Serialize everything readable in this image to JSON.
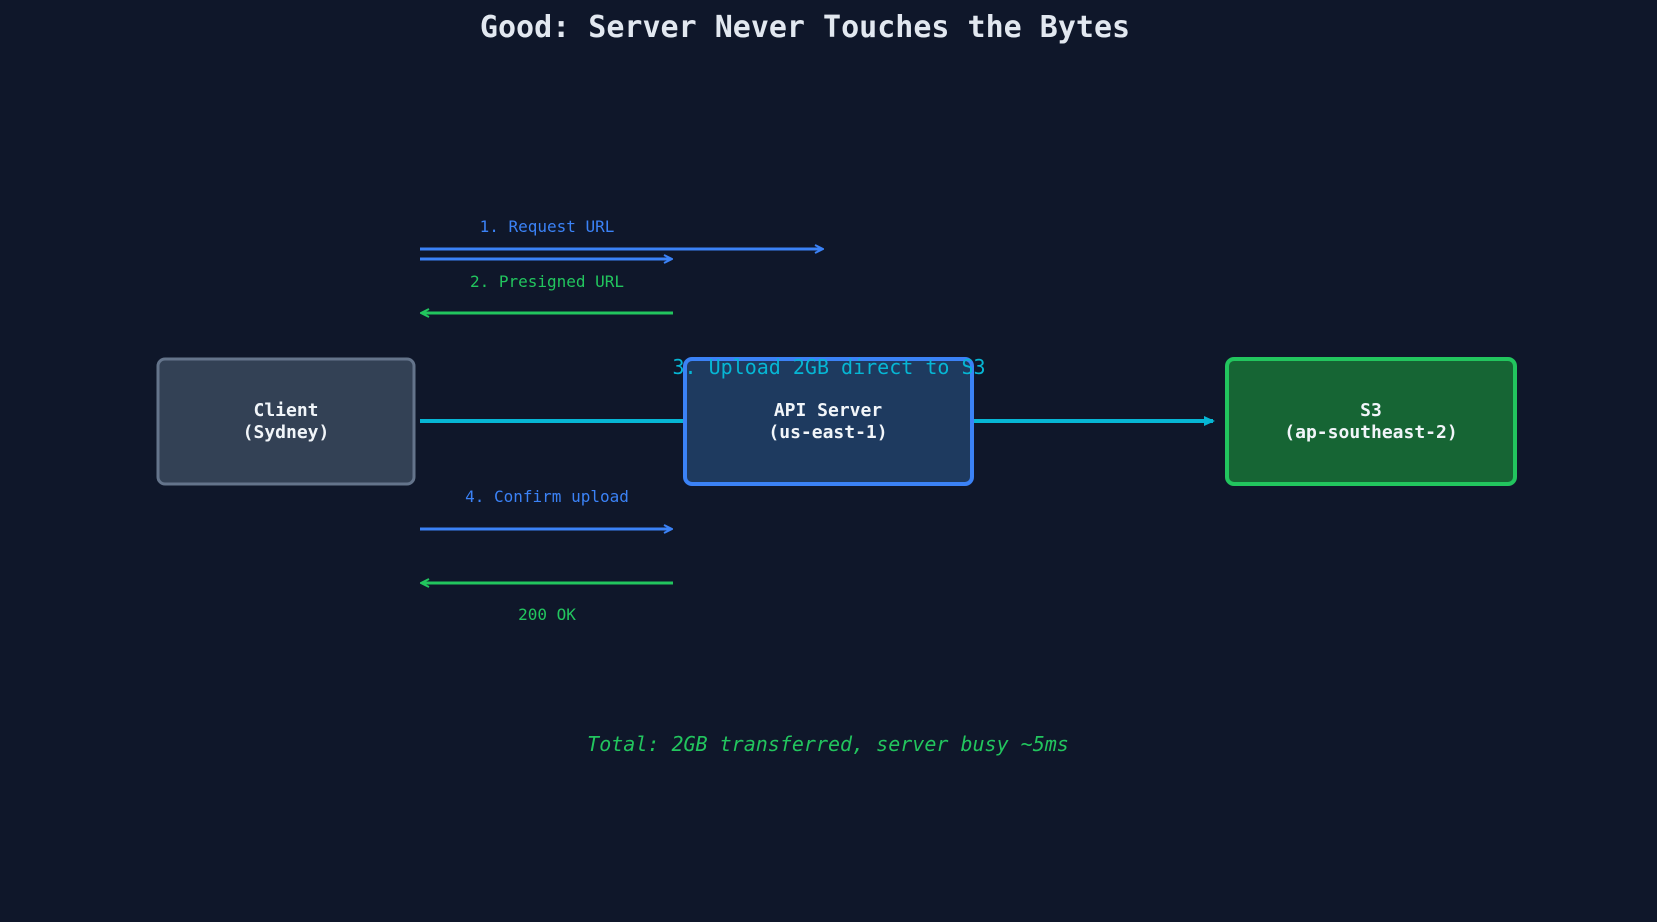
{
  "title": "Good: Server Never Touches the Bytes",
  "nodes": {
    "client": {
      "line1": "Client",
      "line2": "(Sydney)"
    },
    "api": {
      "line1": "API Server",
      "line2": "(us-east-1)"
    },
    "s3": {
      "line1": "S3",
      "line2": "(ap-southeast-2)"
    }
  },
  "steps": {
    "request_url": "1. Request URL",
    "presigned_url": "2. Presigned URL",
    "upload_direct": "3. Upload 2GB direct to S3",
    "confirm_upload": "4. Confirm upload",
    "ok": "200 OK"
  },
  "total": "Total: 2GB transferred, server busy ~5ms",
  "colors": {
    "background": "#0f172a",
    "blue": "#3b82f6",
    "green": "#22c55e",
    "cyan": "#06b6d4",
    "client_fill": "#334155",
    "client_stroke": "#64748b",
    "api_fill": "#1e3a5f",
    "s3_fill": "#166534"
  }
}
